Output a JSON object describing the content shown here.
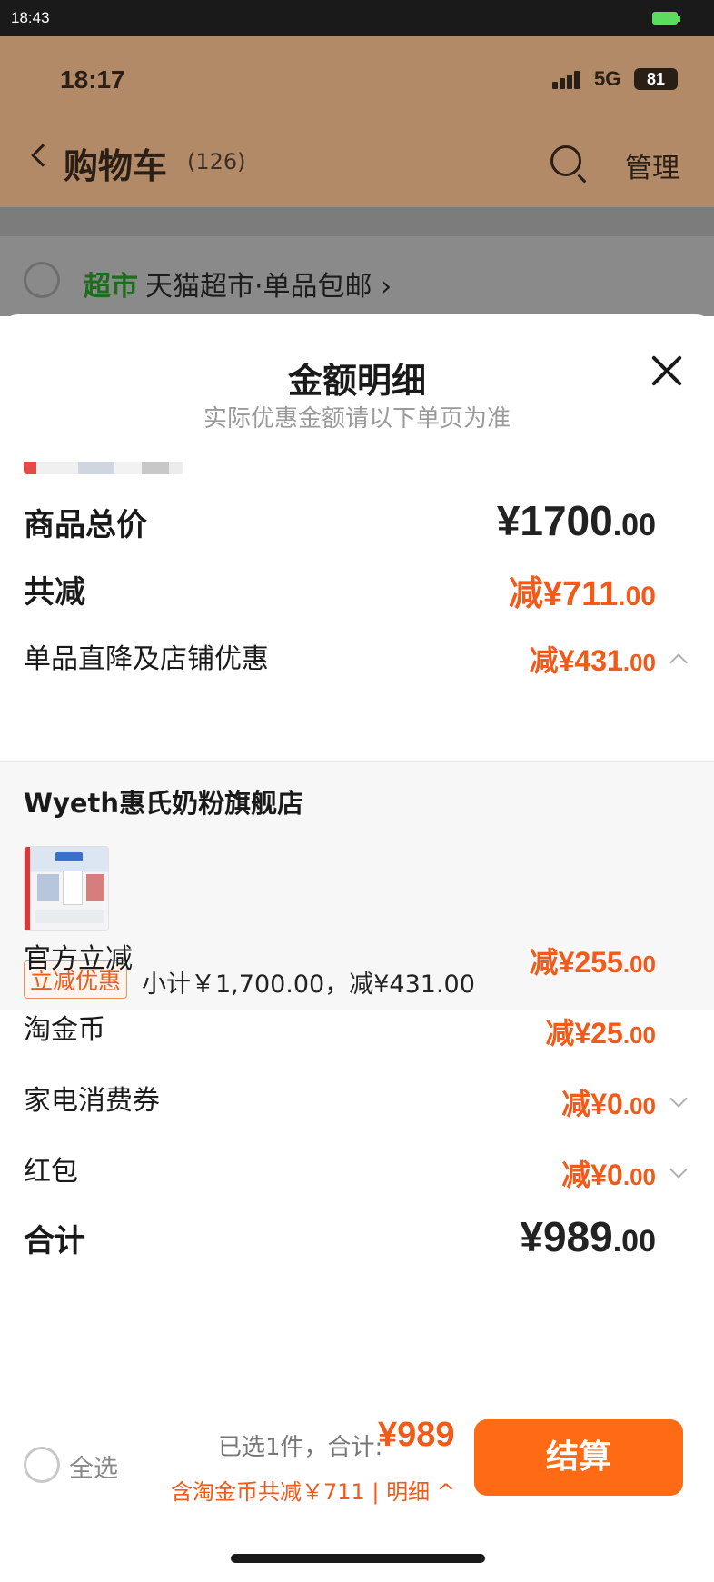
{
  "system_bar": {
    "time": "18:43"
  },
  "ios_status": {
    "time": "18:17",
    "network": "5G",
    "battery": "81"
  },
  "cart_header": {
    "title": "购物车",
    "count": "(126)",
    "manage_label": "管理"
  },
  "store_row": {
    "tag": "超市",
    "name": "天猫超市·单品包邮 ›"
  },
  "sheet": {
    "title": "金额明细",
    "subtitle": "实际优惠金额请以下单页为准",
    "rows": {
      "goods_total": {
        "label": "商品总价",
        "amount_main": "¥1700",
        "amount_dec": ".00"
      },
      "total_reduction": {
        "label": "共减",
        "amount_main": "减¥711",
        "amount_dec": ".00"
      },
      "direct_discount": {
        "label": "单品直降及店铺优惠",
        "amount_main": "减¥431",
        "amount_dec": ".00"
      },
      "official_reduction": {
        "label": "官方立减",
        "amount_main": "减¥255",
        "amount_dec": ".00"
      },
      "taojinbi": {
        "label": "淘金币",
        "amount_main": "减¥25",
        "amount_dec": ".00"
      },
      "appliance_coupon": {
        "label": "家电消费券",
        "amount_main": "减¥0",
        "amount_dec": ".00"
      },
      "red_packet": {
        "label": "红包",
        "amount_main": "减¥0",
        "amount_dec": ".00"
      },
      "grand_total": {
        "label": "合计",
        "amount_main": "¥989",
        "amount_dec": ".00"
      }
    },
    "shop": {
      "name": "Wyeth惠氏奶粉旗舰店",
      "promo_badge": "立减优惠",
      "subtotal": "小计￥1,700.00，减¥431.00"
    }
  },
  "bottom_bar": {
    "select_all": "全选",
    "selected_info": "已选1件，合计:",
    "selected_total": "¥989",
    "discount_line": "含淘金币共减￥711 | 明细 ^",
    "checkout_label": "结算"
  },
  "colors": {
    "accent": "#f05a1a",
    "checkout": "#ff6a14",
    "header_bg": "#b38a67",
    "market_green": "#1d6d1d"
  }
}
